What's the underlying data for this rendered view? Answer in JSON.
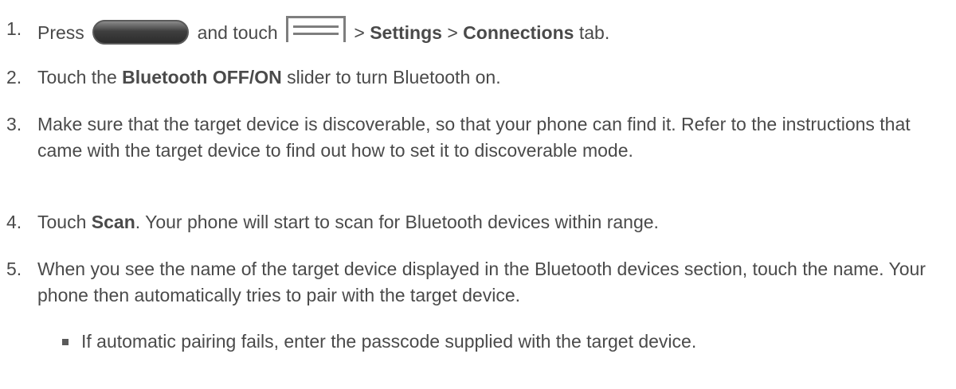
{
  "steps": [
    {
      "num": "1.",
      "press": "Press",
      "home_icon": "home-key-icon",
      "and_touch": "and touch",
      "menu_icon": "menu-icon",
      "sep1": " > ",
      "settings": "Settings",
      "sep2": " > ",
      "connections": "Connections",
      "tab": " tab."
    },
    {
      "num": "2.",
      "before": "Touch the ",
      "bold": "Bluetooth OFF/ON",
      "after": " slider to turn Bluetooth on."
    },
    {
      "num": "3.",
      "text": "Make sure that the target device is discoverable, so that your phone can find it. Refer to the instructions that came with the target device to find out how to set it to discoverable mode."
    },
    {
      "num": "4.",
      "before": "Touch ",
      "bold": "Scan",
      "after": ". Your phone will start to scan for Bluetooth devices within range."
    },
    {
      "num": "5.",
      "text": "When you see the name of the target device displayed in the Bluetooth devices section, touch the name. Your phone then automatically tries to pair with the target device."
    }
  ],
  "subitems": [
    {
      "text": "If automatic pairing fails, enter the passcode supplied with the target device."
    }
  ]
}
